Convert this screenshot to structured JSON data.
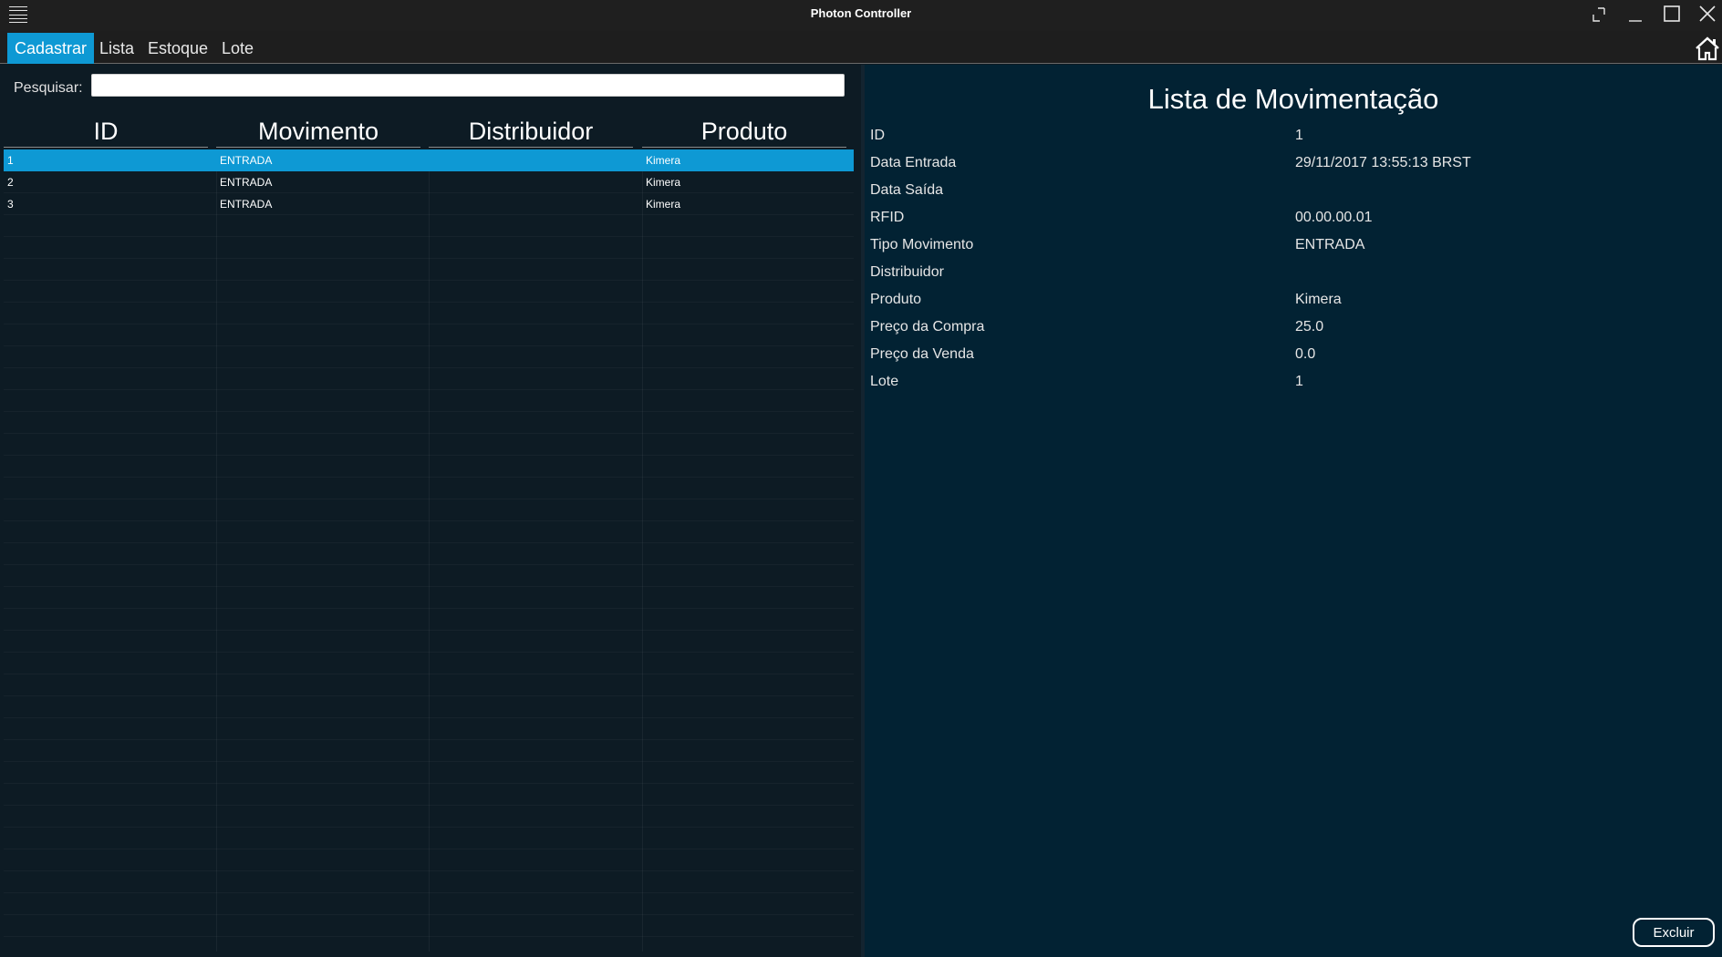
{
  "app": {
    "title": "Photon Controller",
    "icons": {
      "menu": "hamburger-icon",
      "fullscreen": "fullscreen-icon",
      "minimize": "minimize-icon",
      "maximize": "maximize-icon",
      "close": "close-icon",
      "home": "home-icon"
    }
  },
  "menu": {
    "items": [
      {
        "label": "Cadastrar",
        "active": true
      },
      {
        "label": "Lista",
        "active": false
      },
      {
        "label": "Estoque",
        "active": false
      },
      {
        "label": "Lote",
        "active": false
      }
    ]
  },
  "search": {
    "label": "Pesquisar:",
    "value": ""
  },
  "table": {
    "columns": [
      "ID",
      "Movimento",
      "Distribuidor",
      "Produto"
    ],
    "rows": [
      {
        "id": "1",
        "movimento": "ENTRADA",
        "distribuidor": "",
        "produto": "Kimera",
        "selected": true
      },
      {
        "id": "2",
        "movimento": "ENTRADA",
        "distribuidor": "",
        "produto": "Kimera",
        "selected": false
      },
      {
        "id": "3",
        "movimento": "ENTRADA",
        "distribuidor": "",
        "produto": "Kimera",
        "selected": false
      }
    ]
  },
  "details": {
    "title": "Lista de Movimentação",
    "fields": [
      {
        "label": "ID",
        "value": "1"
      },
      {
        "label": "Data Entrada",
        "value": "29/11/2017 13:55:13 BRST"
      },
      {
        "label": "Data Saída",
        "value": ""
      },
      {
        "label": "RFID",
        "value": "00.00.00.01"
      },
      {
        "label": "Tipo Movimento",
        "value": "ENTRADA"
      },
      {
        "label": "Distribuidor",
        "value": ""
      },
      {
        "label": "Produto",
        "value": "Kimera"
      },
      {
        "label": "Preço da Compra",
        "value": "25.0"
      },
      {
        "label": "Preço da Venda",
        "value": "0.0"
      },
      {
        "label": "Lote",
        "value": "1"
      }
    ],
    "delete_label": "Excluir"
  },
  "colors": {
    "accent": "#0e99d4",
    "titlebar": "#1f1f1f",
    "left_bg": "#0d1b24",
    "right_bg": "#022233"
  }
}
